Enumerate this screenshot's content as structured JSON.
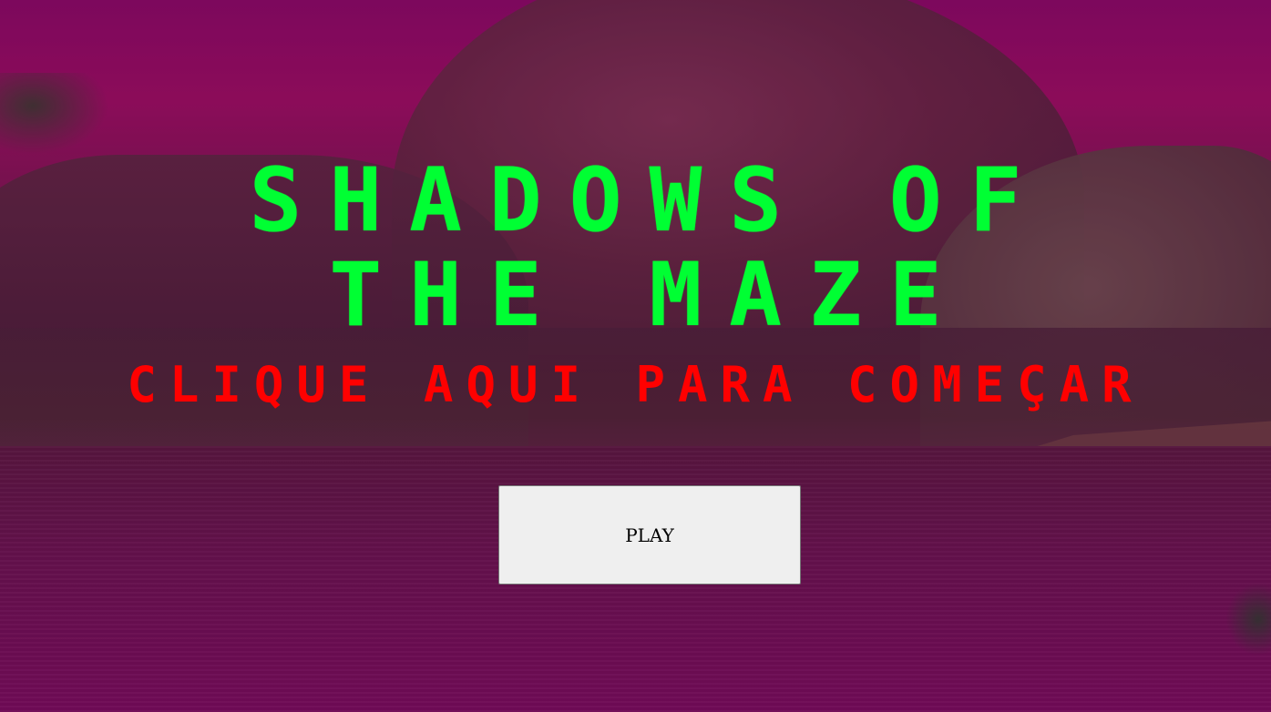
{
  "game": {
    "title_line1": "SHADOWS OF",
    "title_line2": "THE MAZE",
    "subtitle": "CLIQUE AQUI PARA COMEÇAR",
    "play_label": "PLAY"
  },
  "colors": {
    "title": "#00ff33",
    "subtitle": "#ff0000",
    "button_bg": "#efefef",
    "sky": "#8c0f5a"
  }
}
